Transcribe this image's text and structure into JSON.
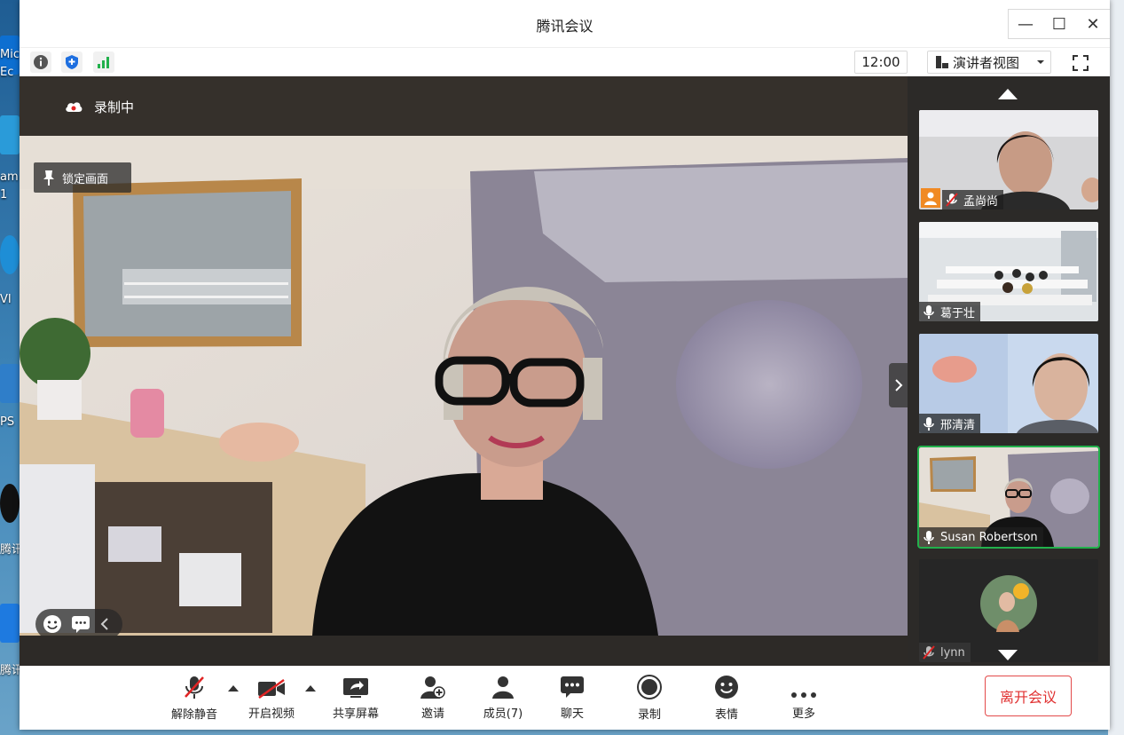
{
  "desktop": {
    "labels": [
      "Micr",
      "Ec",
      "am",
      "1",
      "VI",
      "PS",
      "腾讯",
      "腾讯"
    ]
  },
  "window": {
    "title": "腾讯会议",
    "controls": {
      "minimize": "—",
      "maximize": "☐",
      "close": "✕"
    }
  },
  "toolbar": {
    "time": "12:00",
    "view_mode": "演讲者视图",
    "icons": [
      "info-icon",
      "shield-icon",
      "signal-icon"
    ]
  },
  "stage": {
    "recording_label": "录制中",
    "lock_label": "锁定画面"
  },
  "participants": [
    {
      "name": "孟尚尚",
      "mic": "muted"
    },
    {
      "name": "葛于壮",
      "mic": "on"
    },
    {
      "name": "邢清清",
      "mic": "on"
    },
    {
      "name": "Susan Robertson",
      "mic": "on",
      "active": true
    },
    {
      "name": "lynn",
      "mic": "muted"
    }
  ],
  "controls": {
    "unmute": "解除静音",
    "start_video": "开启视频",
    "share_screen": "共享屏幕",
    "invite": "邀请",
    "members": "成员(7)",
    "chat": "聊天",
    "record": "录制",
    "reactions": "表情",
    "more": "更多",
    "leave": "离开会议"
  },
  "colors": {
    "leave_red": "#e03030",
    "active_border": "#22b14c",
    "mute_red": "#e02424"
  }
}
